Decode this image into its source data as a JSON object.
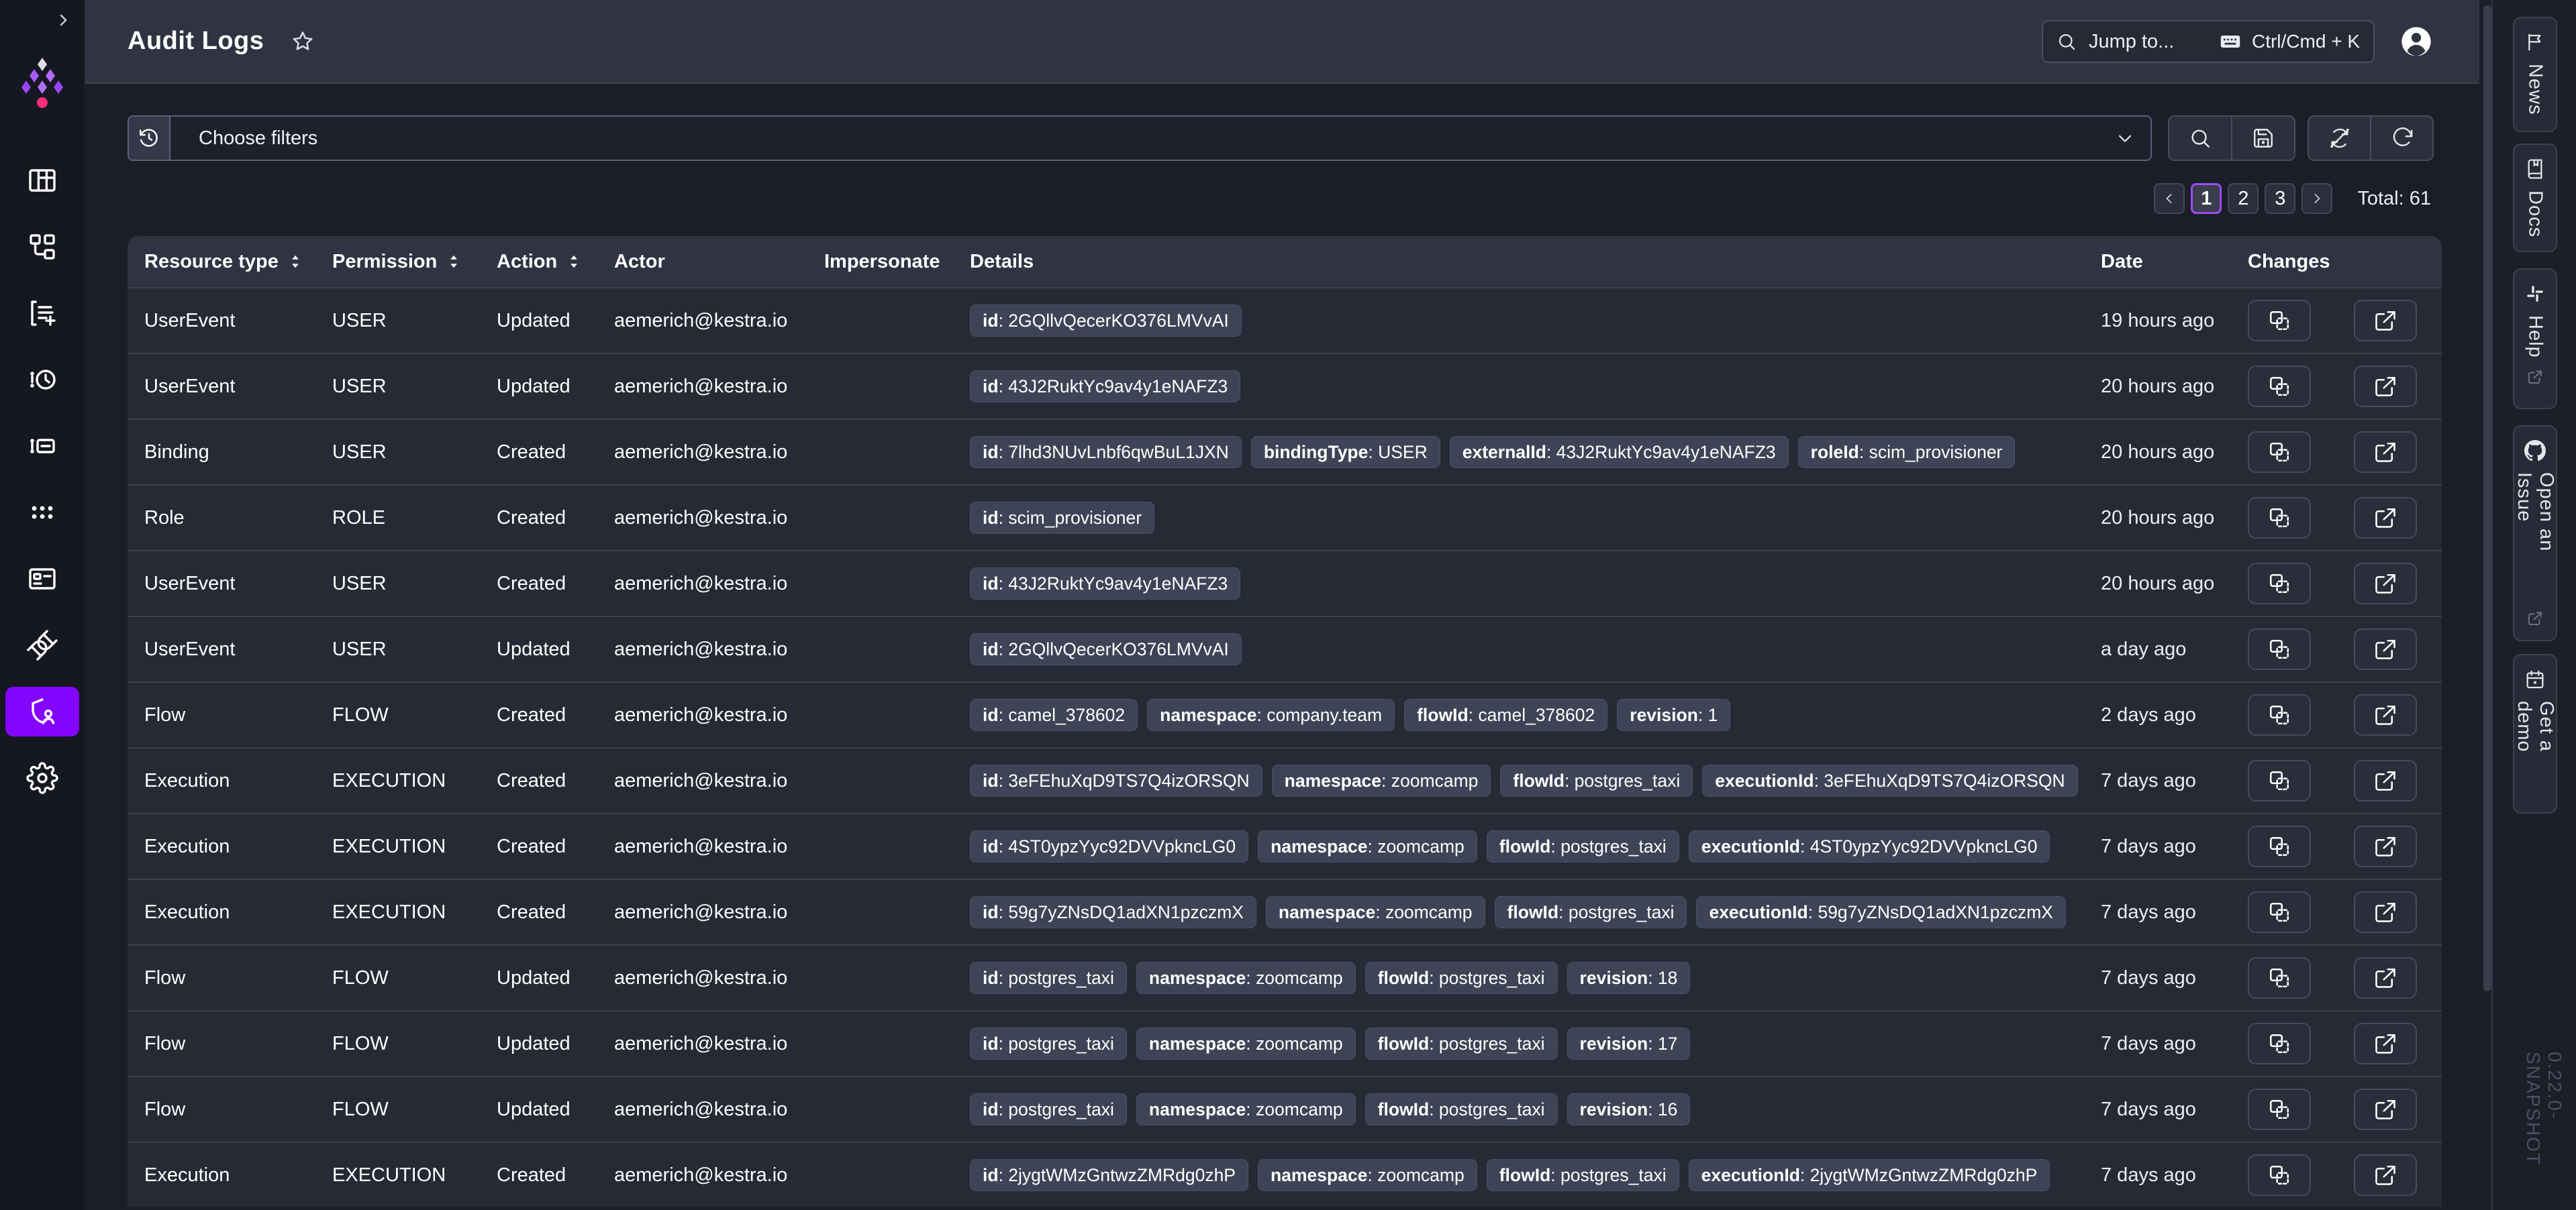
{
  "colors": {
    "accent_purple": "#8405ff",
    "pagination_active_border": "#9a4df5",
    "logo_pink": "#fd2c78",
    "topbar_bg": "#2f3342",
    "page_bg": "#1c1e27",
    "sidebar_bg": "#151721",
    "table_header_bg": "#2f3342",
    "row_bg": "#262a35",
    "badge_bg": "#3e4456"
  },
  "topbar": {
    "title": "Audit Logs",
    "search": {
      "placeholder": "Jump to...",
      "shortcut": "Ctrl/Cmd + K"
    },
    "icons": [
      "star-icon",
      "search-icon",
      "keyboard-icon",
      "user-avatar-icon"
    ]
  },
  "sidebar": {
    "logo_icon": "kestra-logo",
    "collapse_icon": "chevron-right-icon",
    "items": [
      {
        "icon": "dashboard-grid-icon",
        "active": false
      },
      {
        "icon": "flows-hierarchy-icon",
        "active": false
      },
      {
        "icon": "executions-list-plus-icon",
        "active": false
      },
      {
        "icon": "revisions-clock-icon",
        "active": false
      },
      {
        "icon": "logs-icon",
        "active": false
      },
      {
        "icon": "apps-dots-grid-icon",
        "active": false
      },
      {
        "icon": "blueprints-card-icon",
        "active": false
      },
      {
        "icon": "plugins-plug-icon",
        "active": false
      },
      {
        "icon": "administration-shield-user-icon",
        "active": true
      },
      {
        "icon": "settings-gear-icon",
        "active": false
      }
    ]
  },
  "filter_bar": {
    "placeholder": "Choose filters",
    "icons": [
      "history-icon",
      "chevron-down-icon",
      "search-icon",
      "save-icon",
      "auto-refresh-off-icon",
      "refresh-icon"
    ]
  },
  "pagination": {
    "pages": [
      "1",
      "2",
      "3"
    ],
    "current_page": "1",
    "total_label": "Total: 61",
    "icons": [
      "chevron-left-icon",
      "chevron-right-icon"
    ]
  },
  "table": {
    "columns": [
      {
        "label": "Resource type",
        "sortable": true
      },
      {
        "label": "Permission",
        "sortable": true
      },
      {
        "label": "Action",
        "sortable": true
      },
      {
        "label": "Actor",
        "sortable": false
      },
      {
        "label": "Impersonate",
        "sortable": false
      },
      {
        "label": "Details",
        "sortable": false
      },
      {
        "label": "Date",
        "sortable": false
      },
      {
        "label": "Changes",
        "sortable": false
      }
    ],
    "changes_icons": [
      "diff-icon",
      "external-link-icon"
    ],
    "rows": [
      {
        "resource_type": "UserEvent",
        "permission": "USER",
        "action": "Updated",
        "actor": "aemerich@kestra.io",
        "impersonate": "",
        "details": [
          {
            "key": "id",
            "value": "2GQllvQecerKO376LMVvAI"
          }
        ],
        "date": "19 hours ago"
      },
      {
        "resource_type": "UserEvent",
        "permission": "USER",
        "action": "Updated",
        "actor": "aemerich@kestra.io",
        "impersonate": "",
        "details": [
          {
            "key": "id",
            "value": "43J2RuktYc9av4y1eNAFZ3"
          }
        ],
        "date": "20 hours ago"
      },
      {
        "resource_type": "Binding",
        "permission": "USER",
        "action": "Created",
        "actor": "aemerich@kestra.io",
        "impersonate": "",
        "details": [
          {
            "key": "id",
            "value": "7lhd3NUvLnbf6qwBuL1JXN"
          },
          {
            "key": "bindingType",
            "value": "USER"
          },
          {
            "key": "externalId",
            "value": "43J2RuktYc9av4y1eNAFZ3"
          },
          {
            "key": "roleId",
            "value": "scim_provisioner"
          }
        ],
        "date": "20 hours ago"
      },
      {
        "resource_type": "Role",
        "permission": "ROLE",
        "action": "Created",
        "actor": "aemerich@kestra.io",
        "impersonate": "",
        "details": [
          {
            "key": "id",
            "value": "scim_provisioner"
          }
        ],
        "date": "20 hours ago"
      },
      {
        "resource_type": "UserEvent",
        "permission": "USER",
        "action": "Created",
        "actor": "aemerich@kestra.io",
        "impersonate": "",
        "details": [
          {
            "key": "id",
            "value": "43J2RuktYc9av4y1eNAFZ3"
          }
        ],
        "date": "20 hours ago"
      },
      {
        "resource_type": "UserEvent",
        "permission": "USER",
        "action": "Updated",
        "actor": "aemerich@kestra.io",
        "impersonate": "",
        "details": [
          {
            "key": "id",
            "value": "2GQllvQecerKO376LMVvAI"
          }
        ],
        "date": "a day ago"
      },
      {
        "resource_type": "Flow",
        "permission": "FLOW",
        "action": "Created",
        "actor": "aemerich@kestra.io",
        "impersonate": "",
        "details": [
          {
            "key": "id",
            "value": "camel_378602"
          },
          {
            "key": "namespace",
            "value": "company.team"
          },
          {
            "key": "flowId",
            "value": "camel_378602"
          },
          {
            "key": "revision",
            "value": "1"
          }
        ],
        "date": "2 days ago"
      },
      {
        "resource_type": "Execution",
        "permission": "EXECUTION",
        "action": "Created",
        "actor": "aemerich@kestra.io",
        "impersonate": "",
        "details": [
          {
            "key": "id",
            "value": "3eFEhuXqD9TS7Q4izORSQN"
          },
          {
            "key": "namespace",
            "value": "zoomcamp"
          },
          {
            "key": "flowId",
            "value": "postgres_taxi"
          },
          {
            "key": "executionId",
            "value": "3eFEhuXqD9TS7Q4izORSQN"
          }
        ],
        "date": "7 days ago"
      },
      {
        "resource_type": "Execution",
        "permission": "EXECUTION",
        "action": "Created",
        "actor": "aemerich@kestra.io",
        "impersonate": "",
        "details": [
          {
            "key": "id",
            "value": "4ST0ypzYyc92DVVpkncLG0"
          },
          {
            "key": "namespace",
            "value": "zoomcamp"
          },
          {
            "key": "flowId",
            "value": "postgres_taxi"
          },
          {
            "key": "executionId",
            "value": "4ST0ypzYyc92DVVpkncLG0"
          }
        ],
        "date": "7 days ago"
      },
      {
        "resource_type": "Execution",
        "permission": "EXECUTION",
        "action": "Created",
        "actor": "aemerich@kestra.io",
        "impersonate": "",
        "details": [
          {
            "key": "id",
            "value": "59g7yZNsDQ1adXN1pzczmX"
          },
          {
            "key": "namespace",
            "value": "zoomcamp"
          },
          {
            "key": "flowId",
            "value": "postgres_taxi"
          },
          {
            "key": "executionId",
            "value": "59g7yZNsDQ1adXN1pzczmX"
          }
        ],
        "date": "7 days ago"
      },
      {
        "resource_type": "Flow",
        "permission": "FLOW",
        "action": "Updated",
        "actor": "aemerich@kestra.io",
        "impersonate": "",
        "details": [
          {
            "key": "id",
            "value": "postgres_taxi"
          },
          {
            "key": "namespace",
            "value": "zoomcamp"
          },
          {
            "key": "flowId",
            "value": "postgres_taxi"
          },
          {
            "key": "revision",
            "value": "18"
          }
        ],
        "date": "7 days ago"
      },
      {
        "resource_type": "Flow",
        "permission": "FLOW",
        "action": "Updated",
        "actor": "aemerich@kestra.io",
        "impersonate": "",
        "details": [
          {
            "key": "id",
            "value": "postgres_taxi"
          },
          {
            "key": "namespace",
            "value": "zoomcamp"
          },
          {
            "key": "flowId",
            "value": "postgres_taxi"
          },
          {
            "key": "revision",
            "value": "17"
          }
        ],
        "date": "7 days ago"
      },
      {
        "resource_type": "Flow",
        "permission": "FLOW",
        "action": "Updated",
        "actor": "aemerich@kestra.io",
        "impersonate": "",
        "details": [
          {
            "key": "id",
            "value": "postgres_taxi"
          },
          {
            "key": "namespace",
            "value": "zoomcamp"
          },
          {
            "key": "flowId",
            "value": "postgres_taxi"
          },
          {
            "key": "revision",
            "value": "16"
          }
        ],
        "date": "7 days ago"
      },
      {
        "resource_type": "Execution",
        "permission": "EXECUTION",
        "action": "Created",
        "actor": "aemerich@kestra.io",
        "impersonate": "",
        "details": [
          {
            "key": "id",
            "value": "2jygtWMzGntwzZMRdg0zhP"
          },
          {
            "key": "namespace",
            "value": "zoomcamp"
          },
          {
            "key": "flowId",
            "value": "postgres_taxi"
          },
          {
            "key": "executionId",
            "value": "2jygtWMzGntwzZMRdg0zhP"
          }
        ],
        "date": "7 days ago"
      }
    ]
  },
  "right_panel": {
    "tabs": [
      {
        "label": "News",
        "icon": "flag-icon",
        "external": false
      },
      {
        "label": "Docs",
        "icon": "book-icon",
        "external": false
      },
      {
        "label": "Help",
        "icon": "slack-icon",
        "external": true
      },
      {
        "label": "Open an Issue",
        "icon": "github-icon",
        "external": true
      },
      {
        "label": "Get a demo",
        "icon": "calendar-icon",
        "external": false
      }
    ],
    "version": "0.22.0-SNAPSHOT"
  }
}
